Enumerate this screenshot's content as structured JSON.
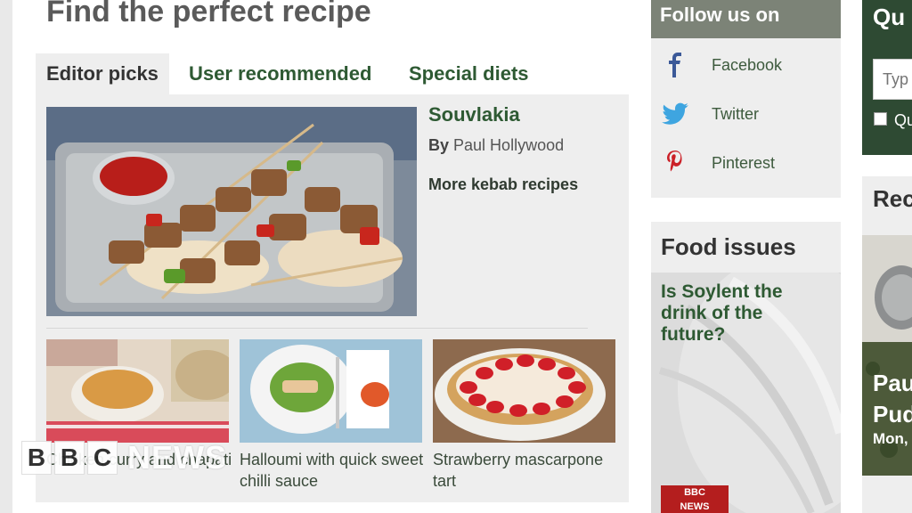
{
  "page": {
    "title": "Find the perfect recipe"
  },
  "tabs": [
    {
      "label": "Editor picks",
      "active": true
    },
    {
      "label": "User recommended",
      "active": false
    },
    {
      "label": "Special diets",
      "active": false
    }
  ],
  "featured": {
    "title": "Souvlakia",
    "author_prefix": "By",
    "author": "Paul Hollywood",
    "more_link": "More kebab recipes"
  },
  "thumbnails": [
    {
      "caption": "Chicken curry and chapati"
    },
    {
      "caption": "Halloumi with quick sweet chilli sauce"
    },
    {
      "caption": "Strawberry mascarpone tart"
    }
  ],
  "watermark": {
    "letters": [
      "B",
      "B",
      "C"
    ],
    "word": "NEWS"
  },
  "follow": {
    "title": "Follow us on",
    "items": [
      {
        "label": "Facebook",
        "icon": "facebook-icon",
        "color": "#3b5998"
      },
      {
        "label": "Twitter",
        "icon": "twitter-icon",
        "color": "#3ea5e0"
      },
      {
        "label": "Pinterest",
        "icon": "pinterest-icon",
        "color": "#cb2027"
      }
    ]
  },
  "food_issues": {
    "title": "Food issues",
    "link": "Is Soylent the drink of the future?",
    "badge_line1": "BBC",
    "badge_line2": "NEWS"
  },
  "quick_search": {
    "title": "Qu",
    "placeholder": "Typ",
    "checkbox_label": "Qu"
  },
  "recommended": {
    "title": "Rec",
    "caption_line1": "Pau",
    "caption_line2": "Pud",
    "date": "Mon,"
  },
  "colors": {
    "link_green": "#2e5a33",
    "follow_header": "#7c8377",
    "quick_box": "#2e4a33",
    "panel_bg": "#eeeeee"
  }
}
